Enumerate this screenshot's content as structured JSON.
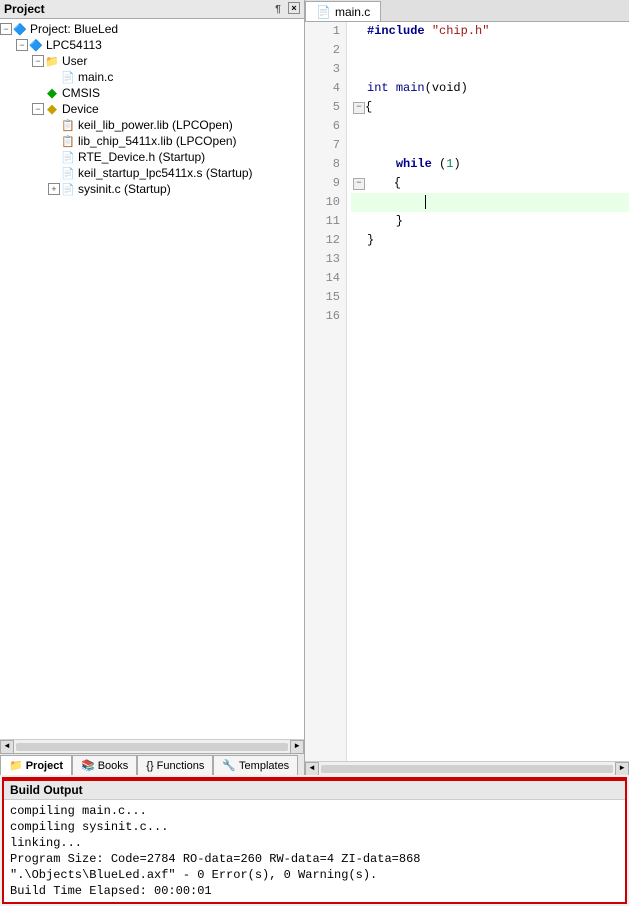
{
  "project_panel": {
    "title": "Project",
    "tree": [
      {
        "id": "project-root",
        "label": "Project: BlueLed",
        "indent": 0,
        "expand": "minus",
        "icon": "project"
      },
      {
        "id": "lpc54113",
        "label": "LPC54113",
        "indent": 1,
        "expand": "minus",
        "icon": "cpu"
      },
      {
        "id": "user",
        "label": "User",
        "indent": 2,
        "expand": "minus",
        "icon": "folder"
      },
      {
        "id": "main-c",
        "label": "main.c",
        "indent": 3,
        "expand": "",
        "icon": "file-c"
      },
      {
        "id": "cmsis",
        "label": "CMSIS",
        "indent": 2,
        "expand": "",
        "icon": "diamond-green"
      },
      {
        "id": "device",
        "label": "Device",
        "indent": 2,
        "expand": "minus",
        "icon": "diamond-yellow"
      },
      {
        "id": "keil-lib-power",
        "label": "keil_lib_power.lib (LPCOpen)",
        "indent": 3,
        "expand": "",
        "icon": "lib"
      },
      {
        "id": "lib-chip",
        "label": "lib_chip_5411x.lib (LPCOpen)",
        "indent": 3,
        "expand": "",
        "icon": "lib"
      },
      {
        "id": "rte-device",
        "label": "RTE_Device.h (Startup)",
        "indent": 3,
        "expand": "",
        "icon": "file-h"
      },
      {
        "id": "keil-startup",
        "label": "keil_startup_lpc5411x.s (Startup)",
        "indent": 3,
        "expand": "",
        "icon": "file-s"
      },
      {
        "id": "sysinit",
        "label": "sysinit.c (Startup)",
        "indent": 3,
        "expand": "plus",
        "icon": "file-c"
      }
    ],
    "tabs": [
      {
        "id": "project-tab",
        "label": "Project",
        "icon": "folder-tab",
        "active": true
      },
      {
        "id": "books-tab",
        "label": "Books",
        "icon": "book-tab",
        "active": false
      },
      {
        "id": "functions-tab",
        "label": "Functions",
        "icon": "fn-tab",
        "active": false
      },
      {
        "id": "templates-tab",
        "label": "Templates",
        "icon": "tmpl-tab",
        "active": false
      }
    ]
  },
  "editor": {
    "tab_label": "main.c",
    "lines": [
      {
        "num": 1,
        "content_type": "include",
        "text": "#include \"chip.h\"",
        "fold": false,
        "highlight": false
      },
      {
        "num": 2,
        "content_type": "blank",
        "text": "",
        "fold": false,
        "highlight": false
      },
      {
        "num": 3,
        "content_type": "blank",
        "text": "",
        "fold": false,
        "highlight": false
      },
      {
        "num": 4,
        "content_type": "code",
        "text": "int main(void)",
        "fold": false,
        "highlight": false
      },
      {
        "num": 5,
        "content_type": "brace-open",
        "text": "{",
        "fold": true,
        "highlight": false
      },
      {
        "num": 6,
        "content_type": "blank",
        "text": "",
        "fold": false,
        "highlight": false
      },
      {
        "num": 7,
        "content_type": "blank",
        "text": "",
        "fold": false,
        "highlight": false
      },
      {
        "num": 8,
        "content_type": "while",
        "text": "    while (1)",
        "fold": false,
        "highlight": false
      },
      {
        "num": 9,
        "content_type": "brace-open",
        "text": "    {",
        "fold": true,
        "highlight": false
      },
      {
        "num": 10,
        "content_type": "cursor",
        "text": "",
        "fold": false,
        "highlight": true
      },
      {
        "num": 11,
        "content_type": "brace-close",
        "text": "    }",
        "fold": false,
        "highlight": false
      },
      {
        "num": 12,
        "content_type": "brace-close",
        "text": "}",
        "fold": false,
        "highlight": false
      },
      {
        "num": 13,
        "content_type": "blank",
        "text": "",
        "fold": false,
        "highlight": false
      },
      {
        "num": 14,
        "content_type": "blank",
        "text": "",
        "fold": false,
        "highlight": false
      },
      {
        "num": 15,
        "content_type": "blank",
        "text": "",
        "fold": false,
        "highlight": false
      },
      {
        "num": 16,
        "content_type": "blank",
        "text": "",
        "fold": false,
        "highlight": false
      }
    ]
  },
  "build_output": {
    "header": "Build Output",
    "lines": [
      "compiling main.c...",
      "compiling sysinit.c...",
      "linking...",
      "Program Size: Code=2784 RO-data=260 RW-data=4 ZI-data=868",
      "\".\\Objects\\BlueLed.axf\" - 0 Error(s), 0 Warning(s).",
      "Build Time Elapsed:  00:00:01"
    ]
  },
  "icons": {
    "close": "×",
    "pin": "¶",
    "minus": "−",
    "plus": "+",
    "arrow_left": "◄",
    "arrow_right": "►",
    "file_icon": "📄",
    "folder_icon": "📁"
  }
}
